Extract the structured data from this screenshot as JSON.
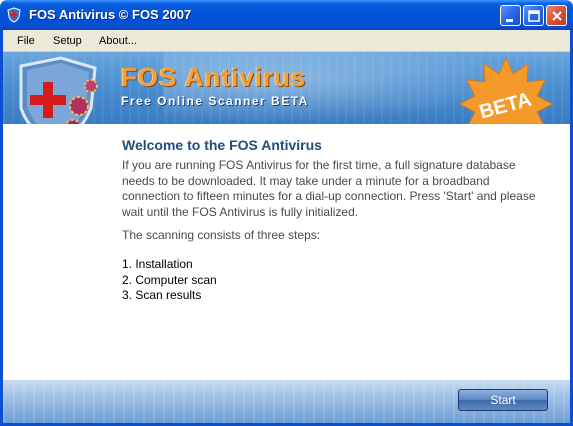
{
  "window": {
    "title": "FOS Antivirus © FOS 2007"
  },
  "menu": {
    "file": "File",
    "setup": "Setup",
    "about": "About..."
  },
  "banner": {
    "title": "FOS Antivirus",
    "subtitle": "Free Online Scanner BETA",
    "badge": "BETA"
  },
  "content": {
    "heading": "Welcome to the FOS Antivirus",
    "paragraph1": "If you are running FOS Antivirus for the first time, a full signature database needs to be downloaded. It may take under a minute for a broadband connection to fifteen minutes for a dial-up connection. Press 'Start' and please wait until the FOS Antivirus is fully initialized.",
    "paragraph2": "The scanning consists of three steps:",
    "steps": [
      "1. Installation",
      "2. Computer scan",
      "3. Scan results"
    ]
  },
  "footer": {
    "start_label": "Start"
  },
  "colors": {
    "titlebar": "#0454d8",
    "accent_orange": "#f0a040",
    "heading_blue": "#1f4e7c"
  },
  "icons": [
    "app-shield-icon",
    "minimize-icon",
    "maximize-icon",
    "close-icon",
    "shield-logo-icon",
    "beta-starburst-icon"
  ]
}
